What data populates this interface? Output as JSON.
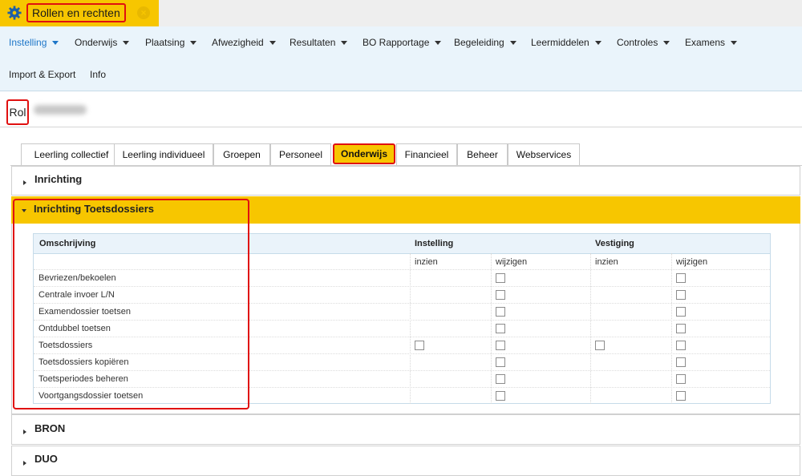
{
  "doc_tab": {
    "title": "Rollen en rechten"
  },
  "menu": {
    "items": [
      {
        "label": "Instelling"
      },
      {
        "label": "Onderwijs"
      },
      {
        "label": "Plaatsing"
      },
      {
        "label": "Afwezigheid"
      },
      {
        "label": "Resultaten"
      },
      {
        "label": "BO Rapportage"
      },
      {
        "label": "Begeleiding"
      },
      {
        "label": "Leermiddelen"
      },
      {
        "label": "Controles"
      },
      {
        "label": "Examens"
      },
      {
        "label": "Import & Export"
      },
      {
        "label": "Info"
      }
    ]
  },
  "rol": {
    "label": "Rol"
  },
  "tabs": [
    {
      "label": "Leerling collectief"
    },
    {
      "label": "Leerling individueel"
    },
    {
      "label": "Groepen"
    },
    {
      "label": "Personeel"
    },
    {
      "label": "Onderwijs"
    },
    {
      "label": "Financieel"
    },
    {
      "label": "Beheer"
    },
    {
      "label": "Webservices"
    }
  ],
  "active_tab": "Onderwijs",
  "sections": {
    "inrichting": "Inrichting",
    "toetsdossiers": "Inrichting Toetsdossiers",
    "bron": "BRON",
    "duo": "DUO"
  },
  "table": {
    "headers": {
      "omschrijving": "Omschrijving",
      "instelling": "Instelling",
      "vestiging": "Vestiging"
    },
    "sub": {
      "inzien": "inzien",
      "wijzigen": "wijzigen"
    },
    "rows": [
      {
        "label": "Bevriezen/bekoelen",
        "inst_inzien": false,
        "inst_wijzigen": true,
        "vest_inzien": false,
        "vest_wijzigen": true
      },
      {
        "label": "Centrale invoer L/N",
        "inst_inzien": false,
        "inst_wijzigen": true,
        "vest_inzien": false,
        "vest_wijzigen": true
      },
      {
        "label": "Examendossier toetsen",
        "inst_inzien": false,
        "inst_wijzigen": true,
        "vest_inzien": false,
        "vest_wijzigen": true
      },
      {
        "label": "Ontdubbel toetsen",
        "inst_inzien": false,
        "inst_wijzigen": true,
        "vest_inzien": false,
        "vest_wijzigen": true
      },
      {
        "label": "Toetsdossiers",
        "inst_inzien": true,
        "inst_wijzigen": true,
        "vest_inzien": true,
        "vest_wijzigen": true
      },
      {
        "label": "Toetsdossiers kopiëren",
        "inst_inzien": false,
        "inst_wijzigen": true,
        "vest_inzien": false,
        "vest_wijzigen": true
      },
      {
        "label": "Toetsperiodes beheren",
        "inst_inzien": false,
        "inst_wijzigen": true,
        "vest_inzien": false,
        "vest_wijzigen": true
      },
      {
        "label": "Voortgangsdossier toetsen",
        "inst_inzien": false,
        "inst_wijzigen": true,
        "vest_inzien": false,
        "vest_wijzigen": true
      }
    ]
  },
  "colors": {
    "accent": "#f7c600",
    "menu_bg": "#eaf4fb",
    "active_link": "#1e76c8",
    "highlight": "#e01010"
  }
}
